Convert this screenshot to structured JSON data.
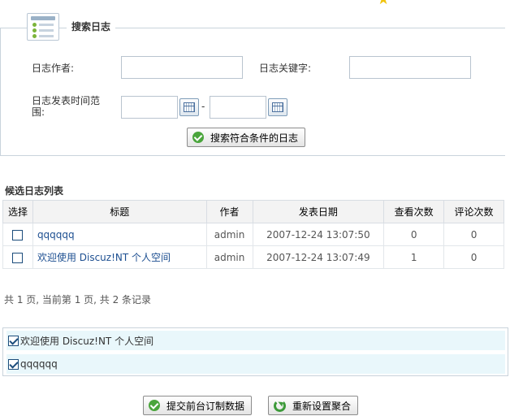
{
  "search": {
    "legend": "搜索日志",
    "author_label": "日志作者:",
    "author_value": "",
    "keyword_label": "日志关键字:",
    "keyword_value": "",
    "date_label": "日志发表时间范围:",
    "date_start": "",
    "date_separator": "-",
    "date_end": "",
    "submit_label": "搜索符合条件的日志"
  },
  "candidates": {
    "title": "候选日志列表",
    "columns": [
      "选择",
      "标题",
      "作者",
      "发表日期",
      "查看次数",
      "评论次数"
    ],
    "rows": [
      {
        "title": "qqqqqq",
        "author": "admin",
        "date": "2007-12-24 13:07:50",
        "views": "0",
        "comments": "0"
      },
      {
        "title": "欢迎使用 Discuz!NT 个人空间",
        "author": "admin",
        "date": "2007-12-24 13:07:49",
        "views": "1",
        "comments": "0"
      }
    ],
    "pager": "共 1 页, 当前第 1 页, 共 2 条记录"
  },
  "selected": {
    "items": [
      "欢迎使用 Discuz!NT 个人空间",
      "qqqqqq"
    ]
  },
  "actions": {
    "submit_label": "提交前台订制数据",
    "reset_label": "重新设置聚合"
  }
}
